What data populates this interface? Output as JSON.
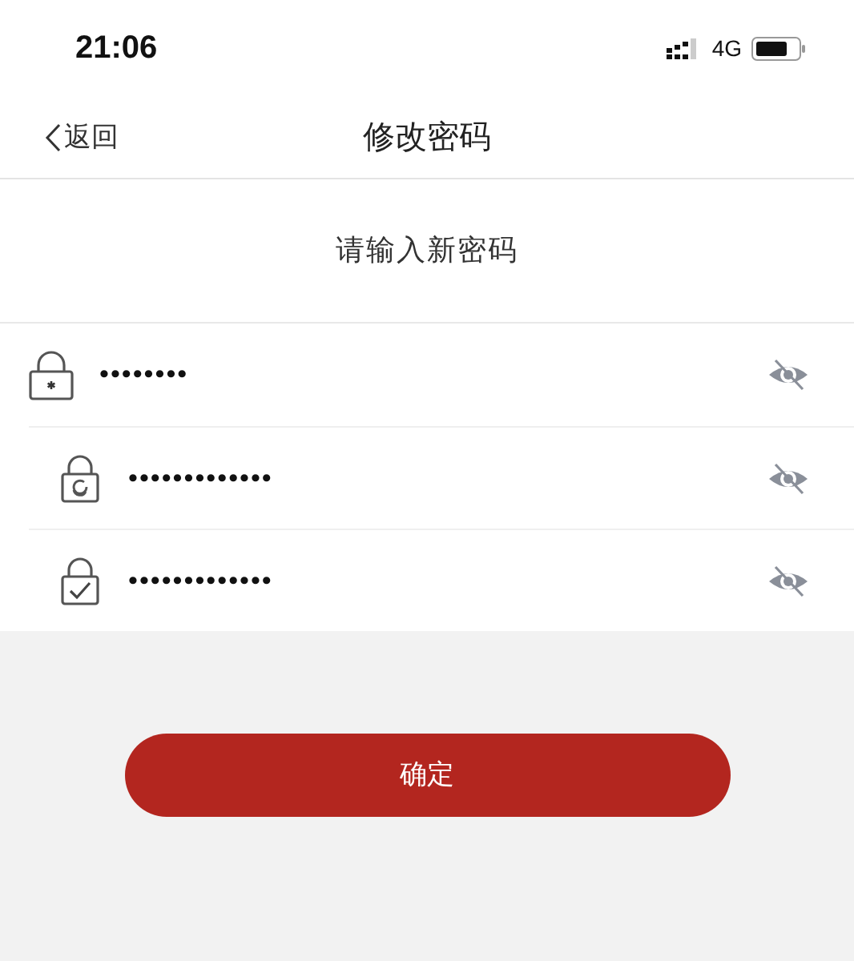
{
  "status_bar": {
    "time": "21:06",
    "network": "4G"
  },
  "nav": {
    "back": "返回",
    "title": "修改密码"
  },
  "prompt": "请输入新密码",
  "fields": [
    {
      "kind": "current",
      "value": "••••••••",
      "revealed": false
    },
    {
      "kind": "new",
      "value": "•••••••••••••",
      "revealed": false
    },
    {
      "kind": "confirm",
      "value": "•••••••••••••",
      "revealed": false
    }
  ],
  "submit": "确定"
}
